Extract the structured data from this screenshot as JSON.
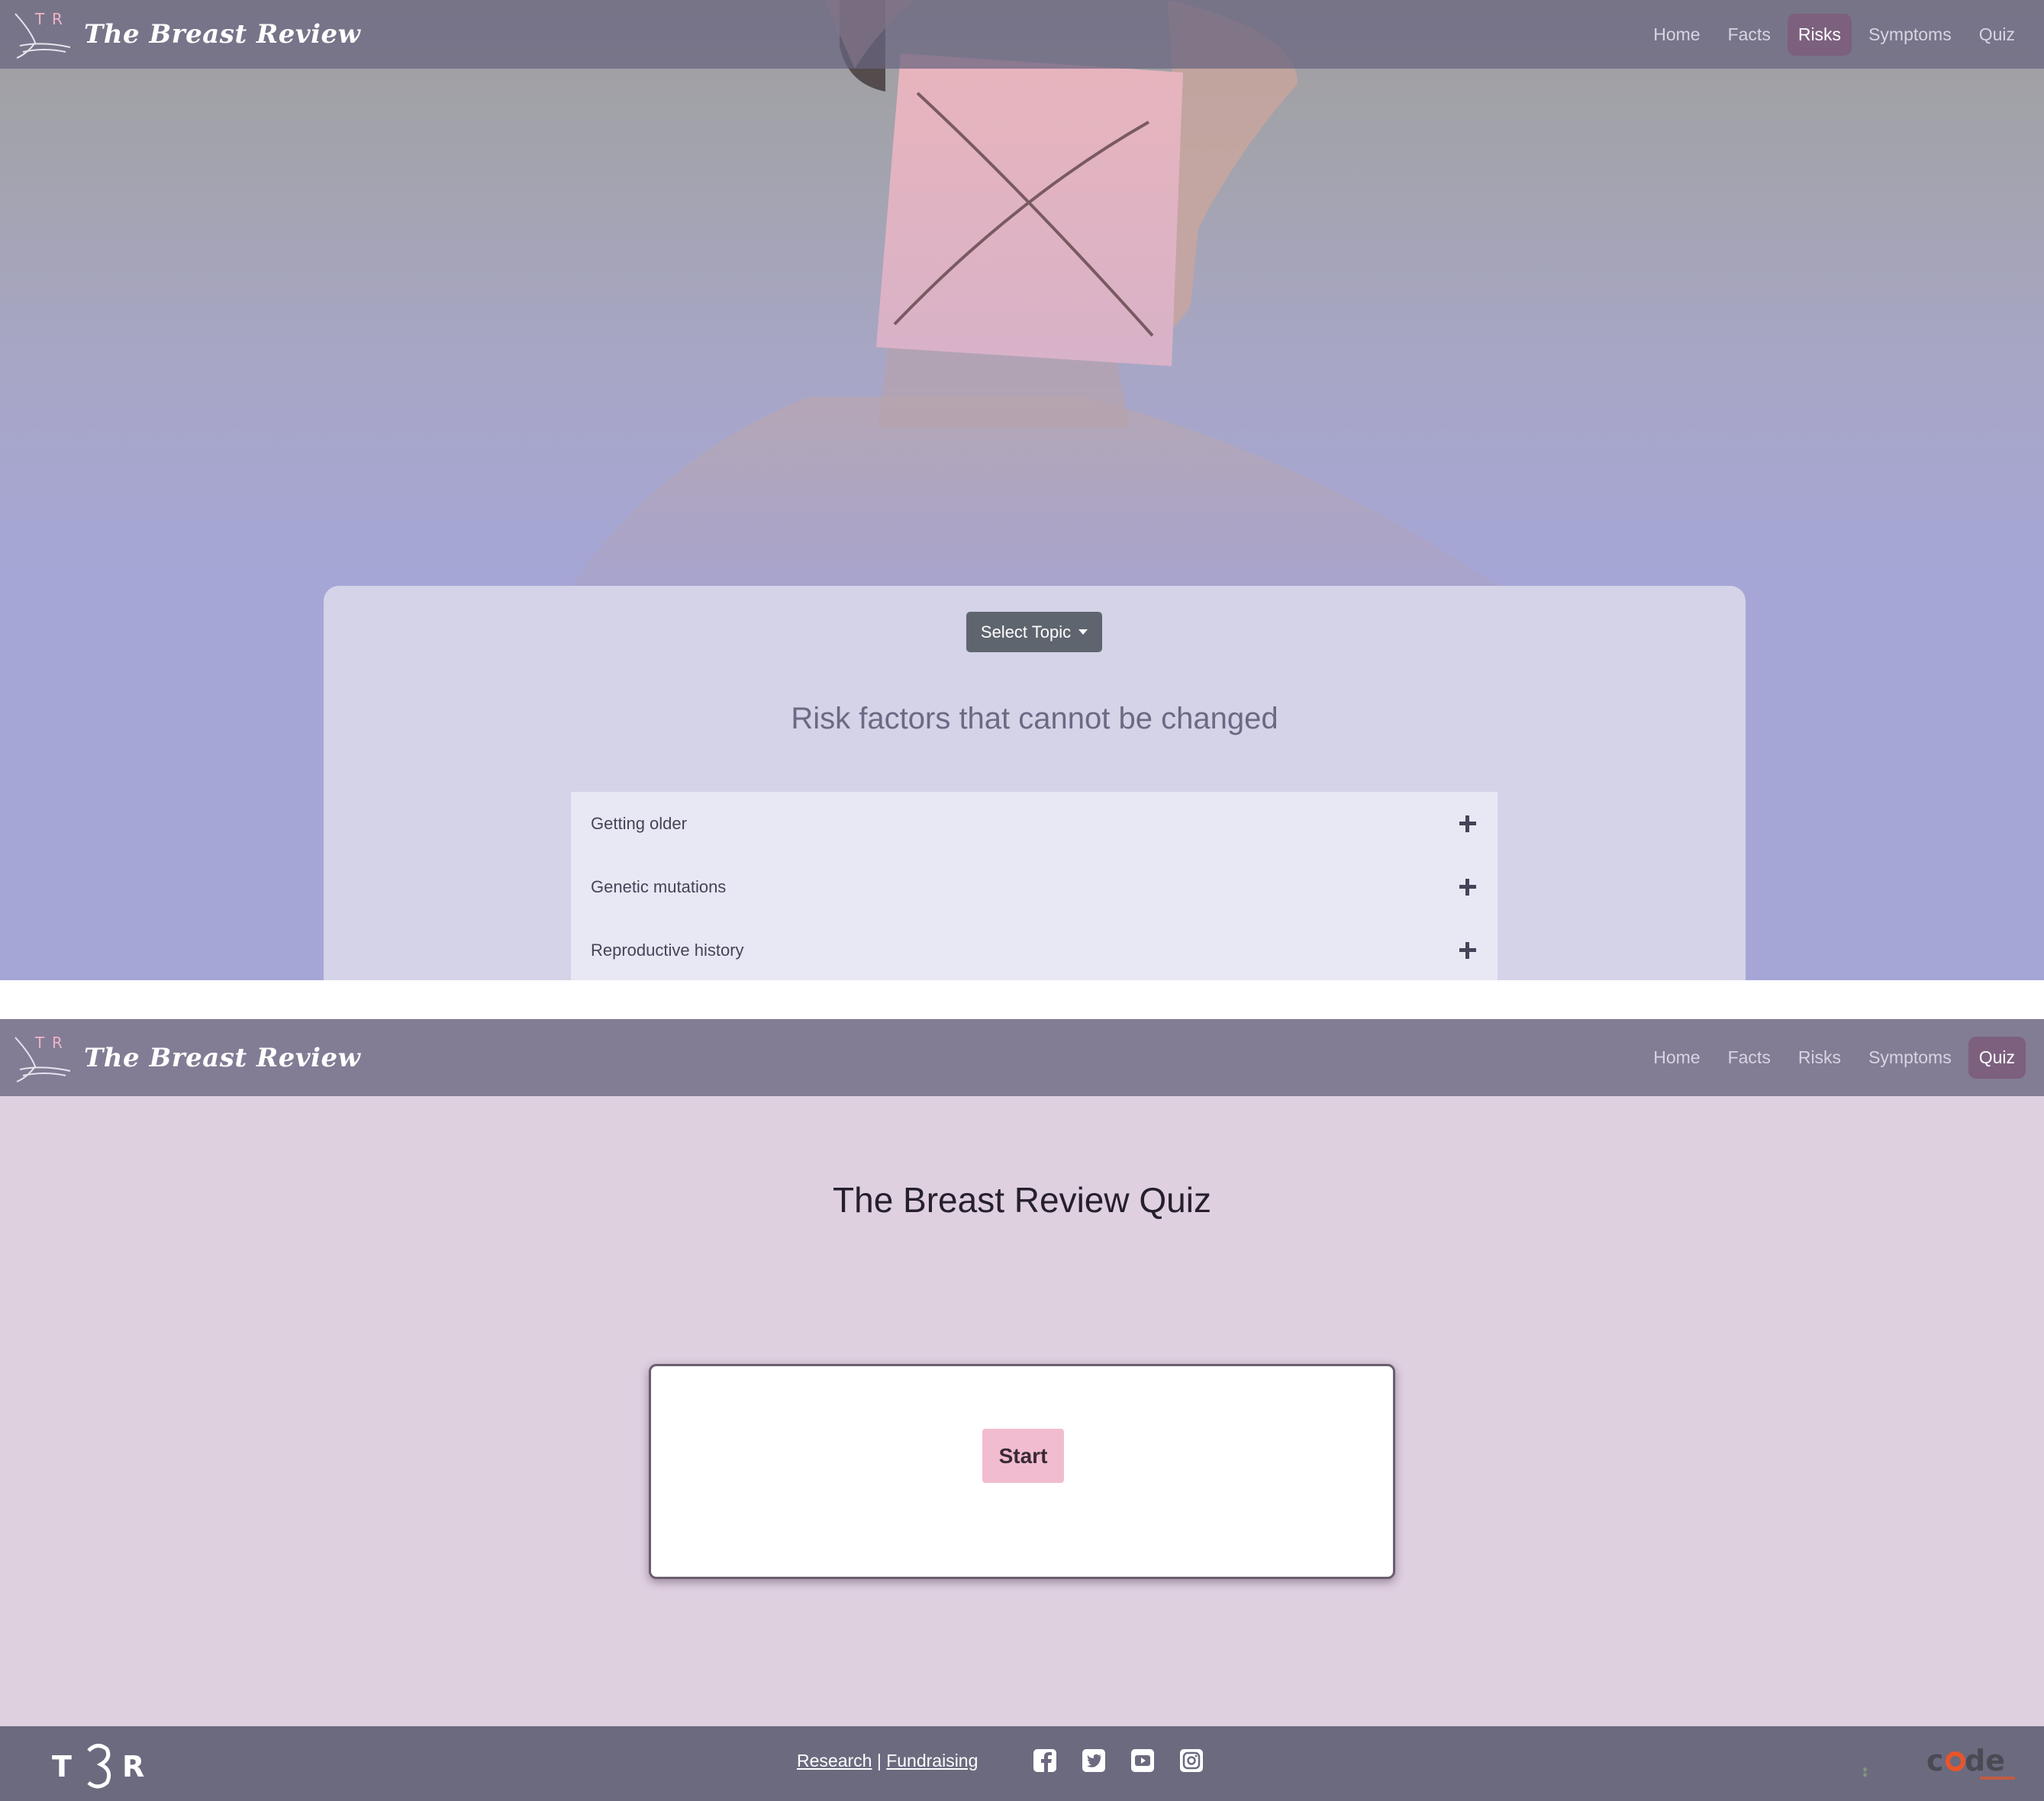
{
  "brand": {
    "name": "The Breast Review",
    "logo_letters": "T R"
  },
  "nav": {
    "items": [
      {
        "label": "Home"
      },
      {
        "label": "Facts"
      },
      {
        "label": "Risks"
      },
      {
        "label": "Symptoms"
      },
      {
        "label": "Quiz"
      }
    ],
    "active_page1": "Risks",
    "active_page2": "Quiz"
  },
  "risks": {
    "select_label": "Select Topic",
    "heading": "Risk factors that cannot be changed",
    "items": [
      {
        "label": "Getting older"
      },
      {
        "label": "Genetic mutations"
      },
      {
        "label": "Reproductive history"
      }
    ]
  },
  "quiz": {
    "title": "The Breast Review Quiz",
    "start_label": "Start"
  },
  "footer": {
    "logo_letters": "T R",
    "research_label": "Research",
    "separator": "|",
    "fundraising_label": "Fundraising",
    "social": [
      "facebook-icon",
      "twitter-icon",
      "youtube-icon",
      "instagram-icon"
    ],
    "partner_logo": "code"
  },
  "colors": {
    "nav_bg": "#827c95",
    "active_nav": "#7c607e",
    "panel": "#d4d3e8",
    "quiz_bg": "#dfd0e0",
    "start_button": "#f2bcd0",
    "footer": "#6b6a7f"
  }
}
